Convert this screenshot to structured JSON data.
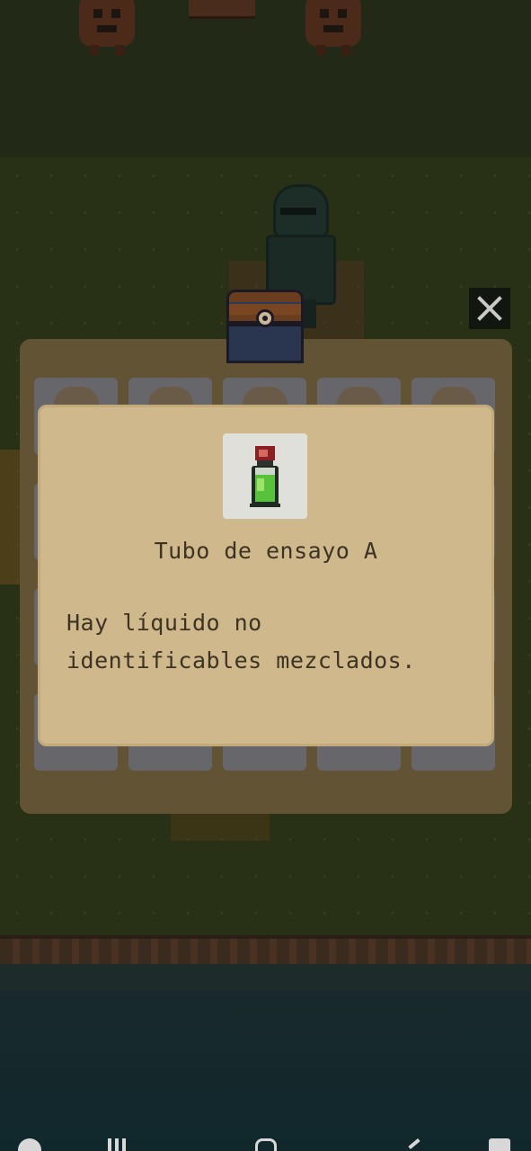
{
  "dialog": {
    "item_name": "Tubo de ensayo A",
    "item_description_line1": "Hay líquido no",
    "item_description_line2": "identificables mezclados.",
    "item_icon": "test-tube-green-liquid-icon",
    "close_icon": "close-icon"
  },
  "colors": {
    "card_background": "#cfb88b",
    "panel_background": "#615333",
    "liquid": "#58c23a",
    "text": "#3d3324"
  },
  "inventory": {
    "slots_per_row": 5,
    "visible_rows": 4
  },
  "system_nav": {
    "icons": [
      "accessibility-icon",
      "recent-apps-icon",
      "home-icon",
      "back-icon",
      "keyboard-icon"
    ]
  }
}
